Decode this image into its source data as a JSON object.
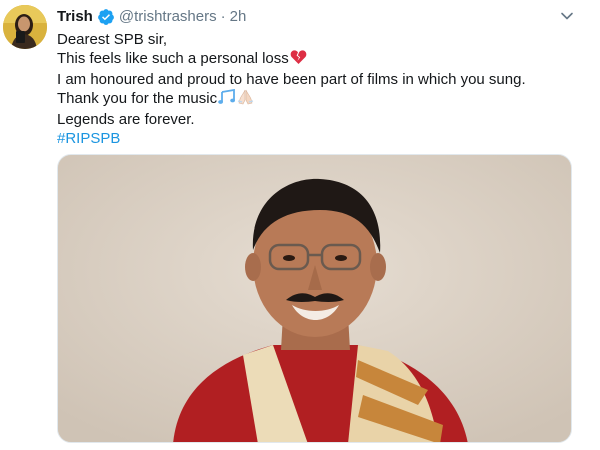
{
  "tweet": {
    "author_name": "Trish",
    "handle": "@trishtrashers",
    "separator": "·",
    "time": "2h",
    "lines": [
      "Dearest SPB sir,",
      "This feels like such a personal loss",
      "I am honoured and proud to have been part of films in which you sung.",
      "Thank you for the music",
      "Legends are forever."
    ],
    "hashtag": "#RIPSPB"
  },
  "icons": {
    "verified": "verified-badge-icon",
    "caret": "chevron-down-icon",
    "broken_heart": "broken-heart-icon",
    "music_notes": "music-notes-icon",
    "folded_hands": "folded-hands-icon"
  },
  "colors": {
    "link": "#1b95e0",
    "secondary_text": "#657786",
    "primary_text": "#14171a"
  }
}
